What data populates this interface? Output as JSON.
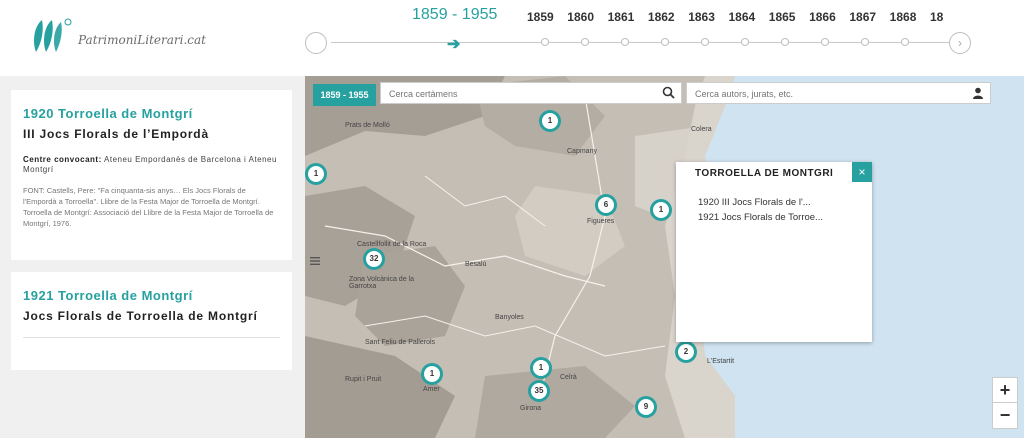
{
  "header": {
    "logo_text": "PatrimoniLiterari.cat",
    "range_label": "1859 - 1955",
    "years": [
      "1859",
      "1860",
      "1861",
      "1862",
      "1863",
      "1864",
      "1865",
      "1866",
      "1867",
      "1868",
      "18"
    ]
  },
  "filters": {
    "range_badge": "1859 - 1955",
    "search_events_placeholder": "Cerca certàmens",
    "search_people_placeholder": "Cerca autors, jurats, etc."
  },
  "cards": [
    {
      "year_place": "1920 Torroella de Montgrí",
      "title": "III Jocs Florals de l’Empordà",
      "convener_label": "Centre convocant:",
      "convener_value": "Ateneu Empordanès de Barcelona i Ateneu Montgrí",
      "font_text": "FONT: Castells, Pere: \"Fa cinquanta-sis anys… Els Jocs Florals de l'Empordà a Torroella\". Llibre de la Festa Major de Torroella de Montgrí. Torroella de Montgrí: Associació del Llibre de la Festa Major de Torroella de Montgrí, 1976."
    },
    {
      "year_place": "1921 Torroella de Montgrí",
      "title": "Jocs Florals de Torroella de Montgrí"
    }
  ],
  "popup": {
    "title": "TORROELLA DE MONTGRÍ",
    "close_label": "×",
    "items": [
      "1920 III Jocs Florals de l'...",
      "1921 Jocs Florals de Torroe..."
    ]
  },
  "markers": [
    "1",
    "1",
    "6",
    "1",
    "32",
    "2",
    "1",
    "35",
    "9",
    "1"
  ],
  "map_labels": {
    "l1": "Prats de Molló",
    "l2": "Capmany",
    "l3": "Figueres",
    "l4": "Castellfollit de la Roca",
    "l5": "Besalú",
    "l6": "Banyoles",
    "l7": "Girona",
    "l8": "Celrà",
    "l9": "Sant Feliu de Pallerols",
    "l10": "Zona Volcànica de la Garrotxa",
    "l11": "Colera",
    "l12": "L'Estartit",
    "l13": "Amer",
    "l14": "Rupit i Pruit"
  },
  "zoom": {
    "in": "+",
    "out": "−"
  },
  "colors": {
    "accent": "#27a0a0",
    "sea": "#cfe3f0"
  }
}
